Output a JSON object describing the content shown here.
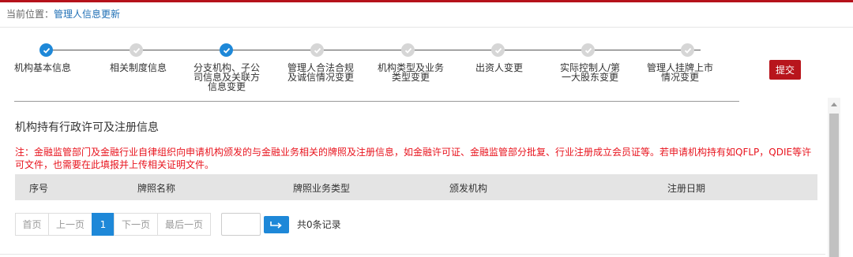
{
  "breadcrumb": {
    "prefix": "当前位置：",
    "current": "管理人信息更新"
  },
  "steps": [
    {
      "label": "机构基本信息",
      "state": "done"
    },
    {
      "label": "相关制度信息",
      "state": "todo"
    },
    {
      "label": "分支机构、子公司信息及关联方信息变更",
      "state": "done"
    },
    {
      "label": "管理人合法合规及诚信情况变更",
      "state": "todo"
    },
    {
      "label": "机构类型及业务类型变更",
      "state": "todo"
    },
    {
      "label": "出资人变更",
      "state": "todo"
    },
    {
      "label": "实际控制人/第一大股东变更",
      "state": "todo"
    },
    {
      "label": "管理人挂牌上市情况变更",
      "state": "todo"
    }
  ],
  "submit_label": "提交",
  "section_title": "机构持有行政许可及注册信息",
  "note": "注：金融监管部门及金融行业自律组织向申请机构颁发的与金融业务相关的牌照及注册信息，如金融许可证、金融监管部分批复、行业注册成立会员证等。若申请机构持有如QFLP，QDIE等许可文件，也需要在此填报并上传相关证明文件。",
  "table": {
    "columns": [
      "序号",
      "牌照名称",
      "牌照业务类型",
      "颁发机构",
      "注册日期"
    ],
    "rows": []
  },
  "pagination": {
    "first": "首页",
    "prev": "上一页",
    "current_page": "1",
    "next": "下一页",
    "last": "最后一页",
    "page_input_value": "",
    "total": "共0条记录"
  },
  "colors": {
    "accent": "#1e88d8",
    "brand": "#b8151c",
    "warning": "#e8141e"
  }
}
